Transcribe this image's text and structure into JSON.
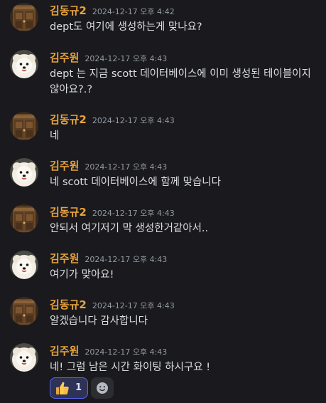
{
  "users": {
    "a": {
      "name": "김동규2",
      "avatar_icon": "wooden-door-icon"
    },
    "b": {
      "name": "김주원",
      "avatar_icon": "pomeranian-dog-icon"
    }
  },
  "colors": {
    "background": "#1a1a1e",
    "author_name": "#e8a33c",
    "timestamp": "#949ba4",
    "message_text": "#dbdee1",
    "reaction_border": "#5865f2"
  },
  "messages": [
    {
      "author": "김동규2",
      "timestamp": "2024-12-17 오후 4:42",
      "text": "dept도 여기에 생성하는게 맞나요?"
    },
    {
      "author": "김주원",
      "timestamp": "2024-12-17 오후 4:43",
      "text": "dept 는 지금 scott 데이터베이스에 이미 생성된 테이블이지 않아요?.?"
    },
    {
      "author": "김동규2",
      "timestamp": "2024-12-17 오후 4:43",
      "text": "네"
    },
    {
      "author": "김주원",
      "timestamp": "2024-12-17 오후 4:43",
      "text": "네 scott 데이터베이스에 함께 맞습니다"
    },
    {
      "author": "김동규2",
      "timestamp": "2024-12-17 오후 4:43",
      "text": "안되서 여기저기 막 생성한거같아서.."
    },
    {
      "author": "김주원",
      "timestamp": "2024-12-17 오후 4:43",
      "text": "여기가 맞아요!"
    },
    {
      "author": "김동규2",
      "timestamp": "2024-12-17 오후 4:43",
      "text": "알겠습니다 감사합니다"
    },
    {
      "author": "김주원",
      "timestamp": "2024-12-17 오후 4:43",
      "text": "네! 그럼 남은 시간 화이팅 하시구요 !"
    }
  ],
  "reaction": {
    "emoji_icon": "thumbs-up-icon",
    "count": "1"
  },
  "add_reaction_icon": "smile-add-reaction-icon"
}
